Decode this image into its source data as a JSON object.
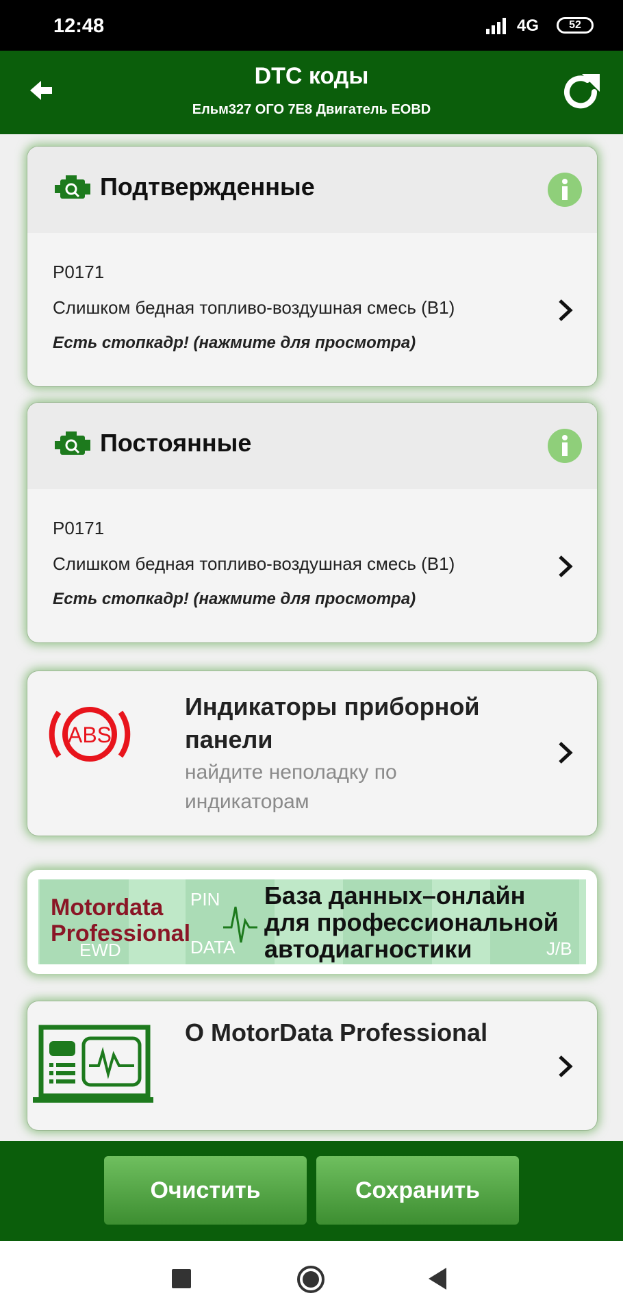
{
  "status": {
    "time": "12:48",
    "network": "4G",
    "battery": "52"
  },
  "header": {
    "title": "DTC коды",
    "subtitle": "Ельм327 ОГО 7E8 Двигатель EOBD"
  },
  "sections": [
    {
      "title": "Подтвержденные",
      "code": "P0171",
      "description": "Слишком бедная топливо-воздушная смесь (B1)",
      "freeze_frame": "Есть стопкадр! (нажмите для просмотра)"
    },
    {
      "title": "Постоянные",
      "code": "P0171",
      "description": "Слишком бедная топливо-воздушная смесь (B1)",
      "freeze_frame": "Есть стопкадр! (нажмите для просмотра)"
    }
  ],
  "indicators": {
    "icon_text": "ABS",
    "title_line1": "Индикаторы приборной",
    "title_line2": "панели",
    "sub_line1": "найдите неполадку по",
    "sub_line2": "индикаторам"
  },
  "banner": {
    "brand_line1": "Motordata",
    "brand_line2": "Professional",
    "text_line1": "База данных–онлайн",
    "text_line2": "для профессиональной",
    "text_line3": "автодиагностики",
    "bg_labels": [
      "EWD",
      "PIN",
      "DATA",
      "J/B"
    ]
  },
  "about": {
    "title": "О MotorData Professional"
  },
  "buttons": {
    "clear": "Очистить",
    "save": "Сохранить"
  },
  "colors": {
    "header": "#0b5e0b",
    "accent": "#1d7a1d",
    "info": "#8fcf7a",
    "abs_red": "#e8141c"
  }
}
